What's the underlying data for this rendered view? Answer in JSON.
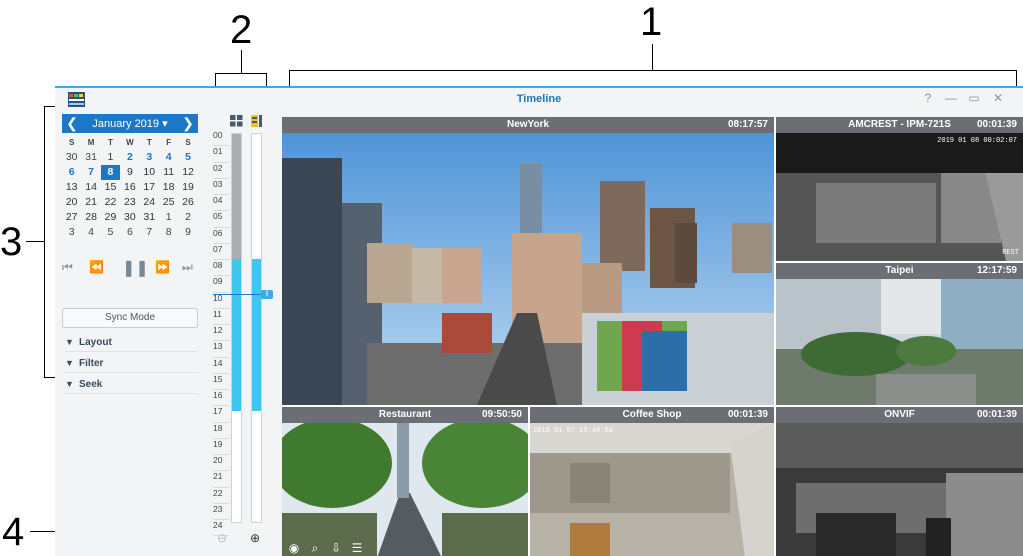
{
  "callouts": [
    "1",
    "2",
    "3",
    "4"
  ],
  "window": {
    "title": "Timeline",
    "controls": {
      "help": "?",
      "minimize": "—",
      "maximize": "▭",
      "close": "✕"
    }
  },
  "calendar": {
    "month_label": "January 2019 ▾",
    "prev": "❮",
    "next": "❯",
    "weekdays": [
      "S",
      "M",
      "T",
      "W",
      "T",
      "F",
      "S"
    ],
    "weeks": [
      [
        "30",
        "31",
        "1",
        "2",
        "3",
        "4",
        "5"
      ],
      [
        "6",
        "7",
        "8",
        "9",
        "10",
        "11",
        "12"
      ],
      [
        "13",
        "14",
        "15",
        "16",
        "17",
        "18",
        "19"
      ],
      [
        "20",
        "21",
        "22",
        "23",
        "24",
        "25",
        "26"
      ],
      [
        "27",
        "28",
        "29",
        "30",
        "31",
        "1",
        "2"
      ],
      [
        "3",
        "4",
        "5",
        "6",
        "7",
        "8",
        "9"
      ]
    ],
    "selected_day": "8"
  },
  "playback": {
    "first": "⏮",
    "rewind": "⏪",
    "pause": "❚❚",
    "forward": "⏩",
    "last": "⏭"
  },
  "sync_mode_label": "Sync Mode",
  "accordion": [
    "Layout",
    "Filter",
    "Seek"
  ],
  "timeline": {
    "hours": [
      "00",
      "01",
      "02",
      "03",
      "04",
      "05",
      "06",
      "07",
      "08",
      "09",
      "10",
      "11",
      "12",
      "13",
      "14",
      "15",
      "16",
      "17",
      "18",
      "19",
      "20",
      "21",
      "22",
      "23",
      "24"
    ],
    "zoom_out": "⊖",
    "zoom_in": "⊕",
    "colors": {
      "recorded": "#3fc6ee",
      "motion": "#a9aeb3",
      "cursor": "#1e77c4"
    }
  },
  "cameras": [
    {
      "name": "NewYork",
      "time": "08:17:57"
    },
    {
      "name": "AMCREST - IPM-721S",
      "time": "00:01:39",
      "osd": "2019 01 08 00:02:07",
      "osd2": "REST"
    },
    {
      "name": "Taipei",
      "time": "12:17:59"
    },
    {
      "name": "Restaurant",
      "time": "09:50:50"
    },
    {
      "name": "Coffee Shop",
      "time": "00:01:39",
      "osd": "2019 01 07 15:48:56"
    },
    {
      "name": "ONVIF",
      "time": "00:01:39"
    }
  ],
  "cam_tools": [
    "camera-icon",
    "zoom-icon",
    "download-icon",
    "settings-icon"
  ],
  "colors": {
    "accent": "#1e77c4",
    "selected_outline": "#e8b92a",
    "title_blue": "#1f77b4"
  }
}
